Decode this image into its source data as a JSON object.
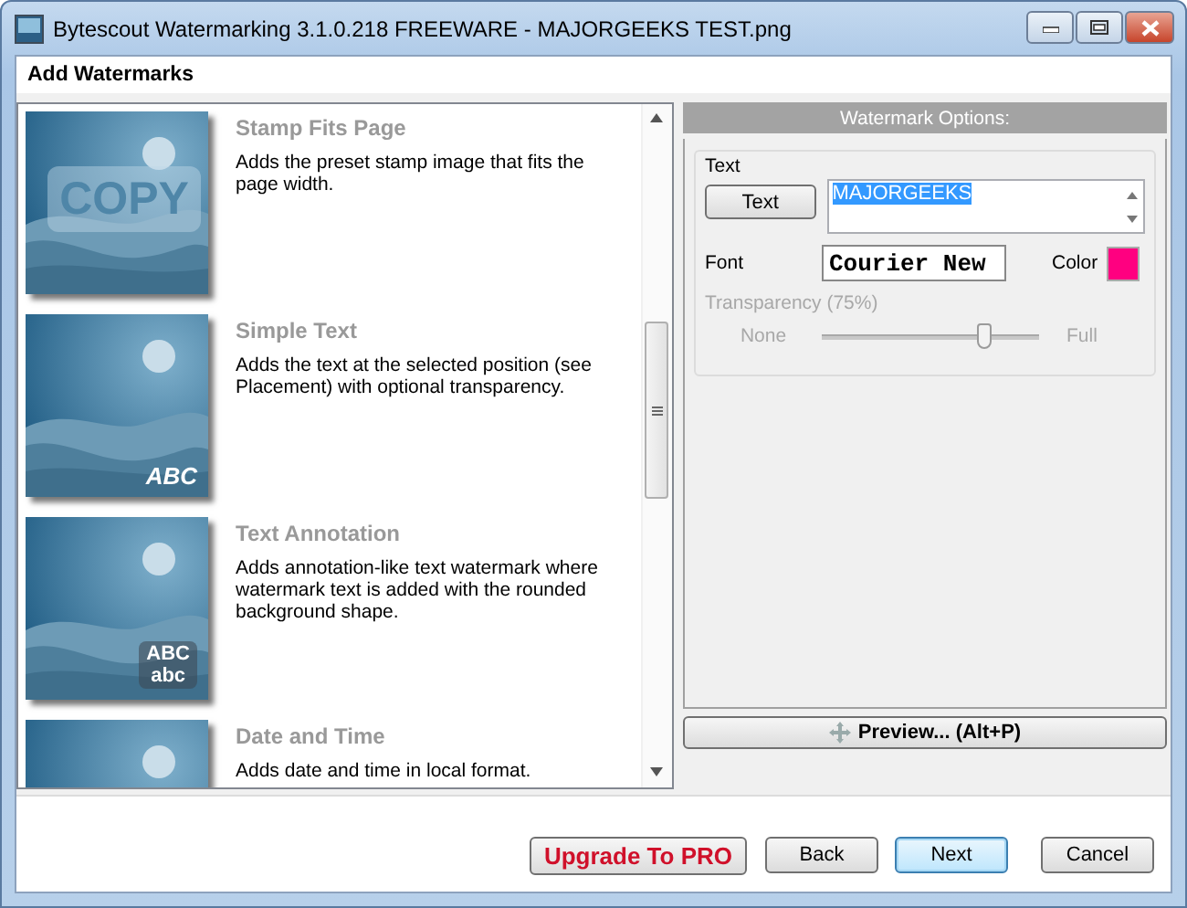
{
  "window": {
    "title": "Bytescout Watermarking 3.1.0.218 FREEWARE - MAJORGEEKS TEST.png"
  },
  "header": {
    "title": "Add Watermarks"
  },
  "watermarks": [
    {
      "title": "Stamp Fits Page",
      "description": "Adds the preset stamp image that fits the page width.",
      "thumbnail": {
        "kind": "stamp",
        "lines": [
          "COPY"
        ]
      }
    },
    {
      "title": "Simple Text",
      "description": "Adds the text at the selected position (see Placement) with optional transparency.",
      "thumbnail": {
        "kind": "corner",
        "lines": [
          "ABC"
        ]
      }
    },
    {
      "title": "Text Annotation",
      "description": "Adds annotation-like text watermark where watermark text is added with the rounded background shape.",
      "thumbnail": {
        "kind": "badge",
        "lines": [
          "ABC",
          "abc"
        ]
      }
    },
    {
      "title": "Date and Time",
      "description": "Adds date and time in local format.",
      "thumbnail": {
        "kind": "plain"
      }
    }
  ],
  "options": {
    "header": "Watermark Options:",
    "group": "Text",
    "text_button": "Text",
    "text_value": "MAJORGEEKS",
    "text_selected": true,
    "font_label": "Font",
    "font_value": "Courier New",
    "color_label": "Color",
    "color": "#ff0080",
    "transparency": {
      "label": "Transparency (75%)",
      "disabled": true,
      "min_label": "None",
      "max_label": "Full",
      "level": 0.75
    },
    "preview_button": "Preview... (Alt+P)"
  },
  "footer": {
    "upgrade": "Upgrade To PRO",
    "buttons": [
      {
        "label": "Back",
        "focused": false
      },
      {
        "label": "Next",
        "focused": true
      },
      {
        "label": "Cancel",
        "focused": false
      }
    ]
  }
}
